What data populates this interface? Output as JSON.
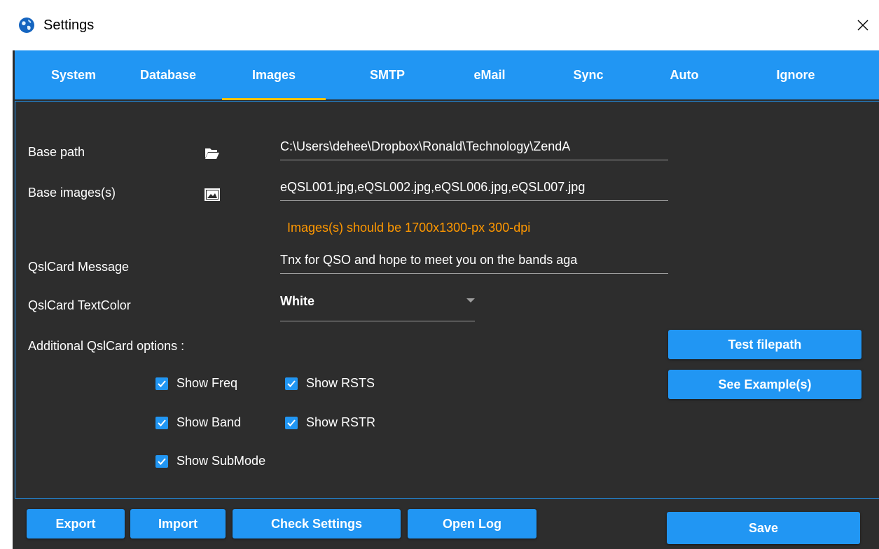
{
  "window": {
    "title": "Settings"
  },
  "tabs": [
    {
      "label": "System"
    },
    {
      "label": "Database"
    },
    {
      "label": "Images"
    },
    {
      "label": "SMTP"
    },
    {
      "label": "eMail"
    },
    {
      "label": "Sync"
    },
    {
      "label": "Auto"
    },
    {
      "label": "Ignore"
    }
  ],
  "active_tab": "Images",
  "form": {
    "base_path": {
      "label": "Base path",
      "value": "C:\\Users\\dehee\\Dropbox\\Ronald\\Technology\\ZendA"
    },
    "base_images": {
      "label": "Base images(s)",
      "value": "eQSL001.jpg,eQSL002.jpg,eQSL006.jpg,eQSL007.jpg"
    },
    "hint": "Images(s) should be 1700x1300-px 300-dpi",
    "qsl_message": {
      "label": "QslCard Message",
      "value": "Tnx for QSO and hope to meet you on the bands aga"
    },
    "text_color": {
      "label": "QslCard TextColor",
      "value": "White"
    },
    "additional_label": "Additional QslCard options :",
    "options": {
      "show_freq": {
        "label": "Show Freq",
        "checked": true
      },
      "show_rsts": {
        "label": "Show RSTS",
        "checked": true
      },
      "show_band": {
        "label": "Show Band",
        "checked": true
      },
      "show_rstr": {
        "label": "Show RSTR",
        "checked": true
      },
      "show_submode": {
        "label": "Show SubMode",
        "checked": true
      }
    }
  },
  "side_buttons": {
    "test_filepath": "Test filepath",
    "see_examples": "See Example(s)"
  },
  "footer": {
    "export": "Export",
    "import": "Import",
    "check_settings": "Check Settings",
    "open_log": "Open Log",
    "save": "Save"
  },
  "colors": {
    "accent": "#2196f3",
    "background": "#2d2d2d",
    "hint": "#ff9800",
    "indicator": "#ffc107"
  },
  "icons": {
    "app": "globe-icon",
    "close": "close-icon",
    "folder": "folder-open-icon",
    "image": "image-icon",
    "check": "checkmark-icon"
  }
}
